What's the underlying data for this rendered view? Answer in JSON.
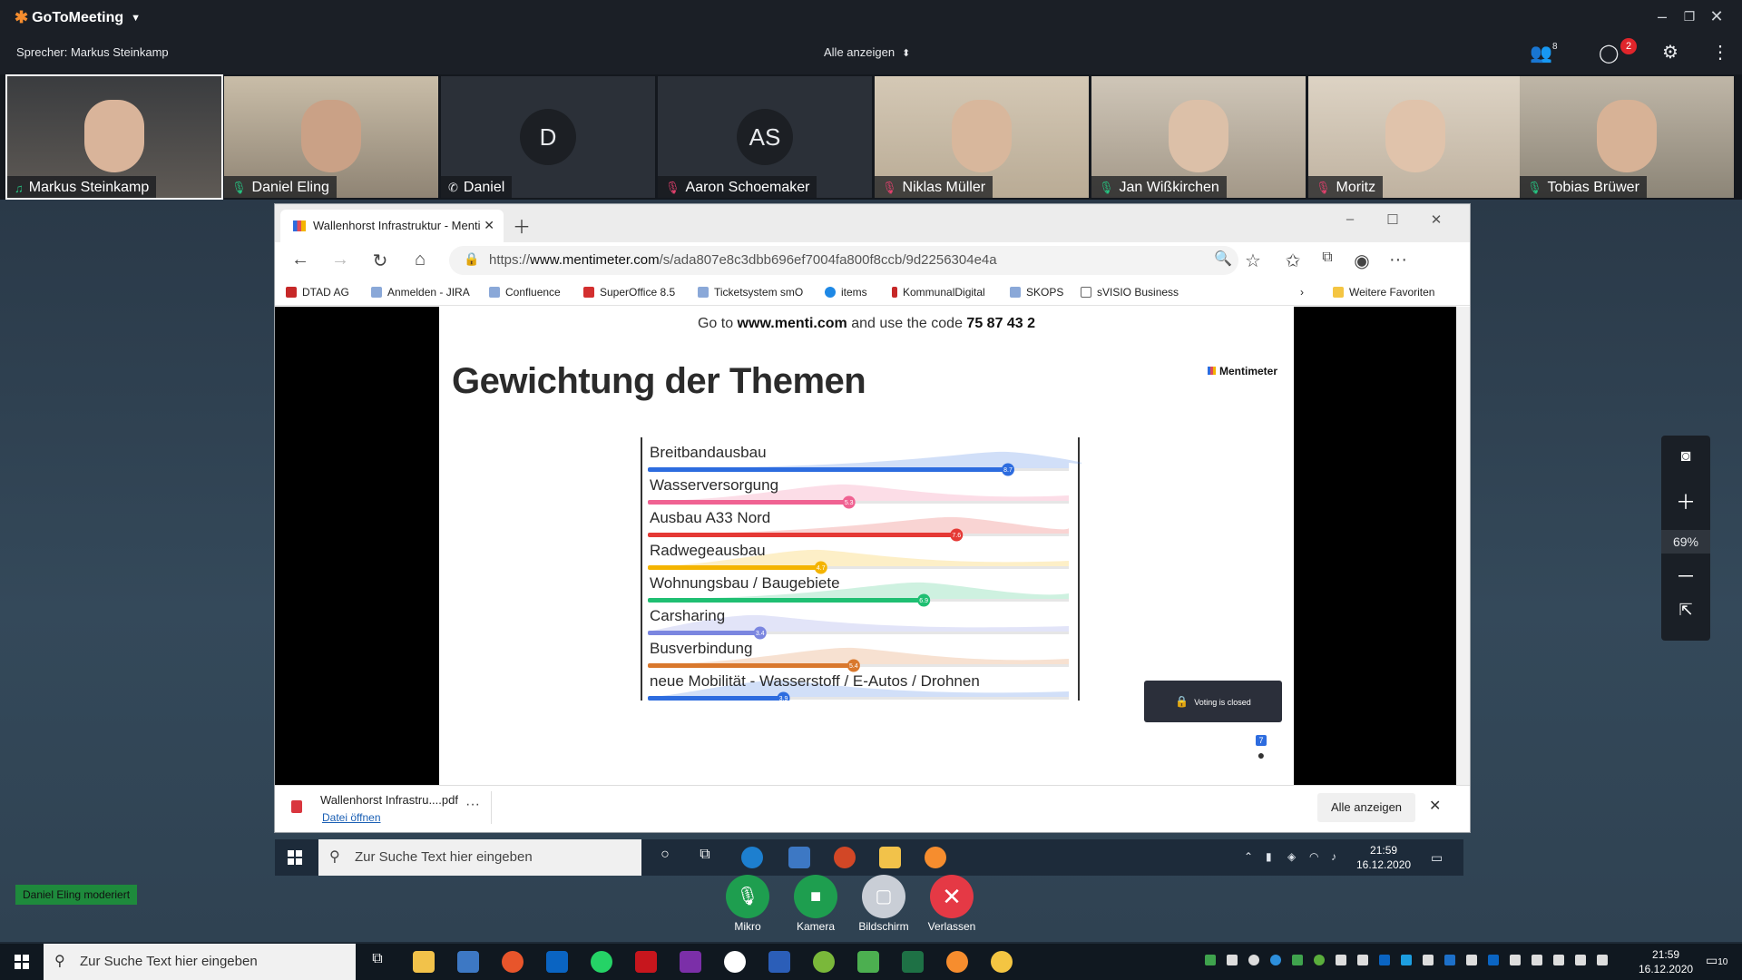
{
  "app": {
    "name": "GoToMeeting",
    "speaker_label": "Sprecher: Markus Steinkamp",
    "show_all": "Alle anzeigen",
    "participants_count": "8",
    "chat_badge": "2"
  },
  "participants": [
    {
      "name": "Markus Steinkamp",
      "audio": "speaking",
      "type": "video"
    },
    {
      "name": "Daniel Eling",
      "audio": "on",
      "type": "video"
    },
    {
      "name": "Daniel",
      "audio": "phone",
      "type": "avatar",
      "initials": "D"
    },
    {
      "name": "Aaron Schoemaker",
      "audio": "muted",
      "type": "avatar",
      "initials": "AS"
    },
    {
      "name": "Niklas Müller",
      "audio": "muted",
      "type": "video"
    },
    {
      "name": "Jan Wißkirchen",
      "audio": "on",
      "type": "video"
    },
    {
      "name": "Moritz",
      "audio": "muted",
      "type": "video"
    },
    {
      "name": "Tobias Brüwer",
      "audio": "on",
      "type": "video"
    }
  ],
  "browser": {
    "tab_title": "Wallenhorst Infrastruktur - Menti",
    "url_prefix": "https://",
    "url_host": "www.mentimeter.com",
    "url_path": "/s/ada807e8c3dbb696ef7004fa800f8ccb/9d2256304e4a",
    "bookmarks": [
      "DTAD AG",
      "Anmelden - JIRA",
      "Confluence",
      "SuperOffice 8.5",
      "Ticketsystem smO",
      "items",
      "KommunalDigital",
      "SKOPS",
      "sVISIO Business"
    ],
    "more_favorites": "Weitere Favoriten"
  },
  "slide": {
    "hint_prefix": "Go to",
    "hint_site": "www.menti.com",
    "hint_mid": "and use the code",
    "hint_code": "75 87 43 2",
    "title": "Gewichtung der Themen",
    "logo": "Mentimeter",
    "voting_closed": "Voting is closed",
    "respondents": "7"
  },
  "chart_data": {
    "type": "bar",
    "categories": [
      "Breitbandausbau",
      "Wasserversorgung",
      "Ausbau A33 Nord",
      "Radwegeausbau",
      "Wohnungsbau / Baugebiete",
      "Carsharing",
      "Busverbindung",
      "neue Mobilität - Wasserstoff / E-Autos / Drohnen"
    ],
    "values": [
      8.7,
      5.3,
      7.6,
      4.7,
      6.9,
      3.4,
      5.4,
      3.9
    ],
    "colors": [
      "#2d6cdf",
      "#f06292",
      "#e53935",
      "#f4b400",
      "#1fbf72",
      "#7b86e0",
      "#d9782d",
      "#2d6cdf"
    ],
    "xlim": [
      1,
      10
    ],
    "grid": false
  },
  "download": {
    "file": "Wallenhorst Infrastru....pdf",
    "open": "Datei öffnen",
    "show_all": "Alle anzeigen"
  },
  "remote_taskbar": {
    "search_placeholder": "Zur Suche Text hier eingeben",
    "time": "21:59",
    "date": "16.12.2020"
  },
  "zoom": {
    "percent": "69%"
  },
  "moderator": "Daniel Eling moderiert",
  "controls": {
    "mic": "Mikro",
    "camera": "Kamera",
    "screen": "Bildschirm",
    "leave": "Verlassen"
  },
  "taskbar": {
    "search_placeholder": "Zur Suche Text hier eingeben",
    "time": "21:59",
    "date": "16.12.2020",
    "notifications": "10"
  }
}
